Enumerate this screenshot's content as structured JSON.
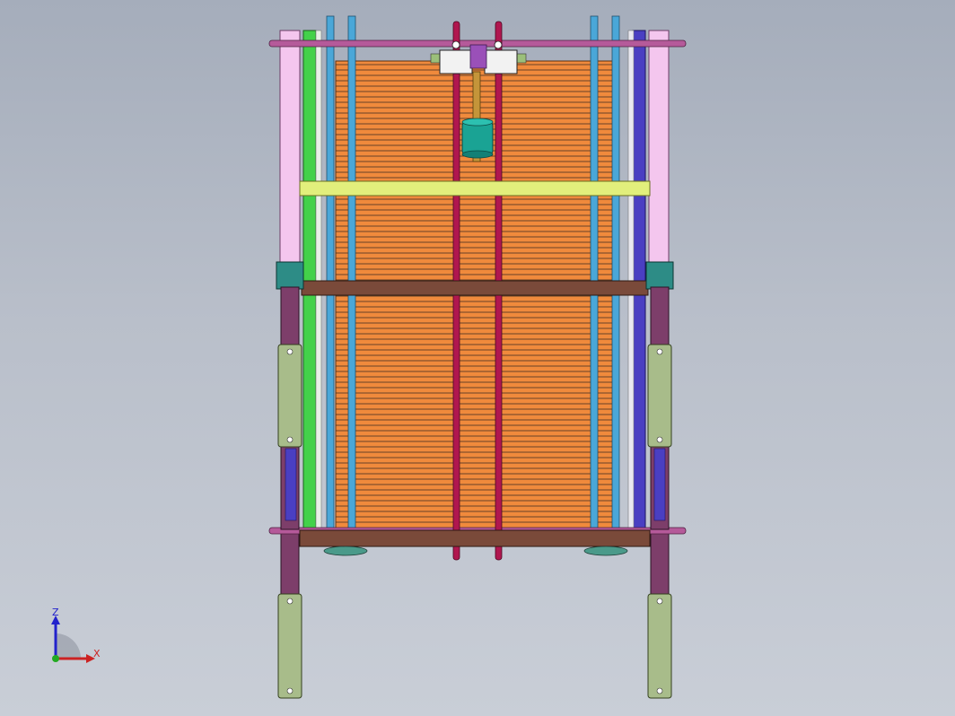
{
  "viewport": {
    "colors": {
      "background_top": "#a5adbb",
      "background_bottom": "#c9ced7",
      "pink_post": "#f4c6ee",
      "green_frame": "#43d14a",
      "purple_frame": "#4a3fc2",
      "blue_rod": "#4aa7d8",
      "crimson_rod": "#b0174f",
      "mauve_rod": "#b55a9a",
      "orange_plates": "#f08a3c",
      "plate_lines": "#3a2a20",
      "yellow_bar": "#e2ef7c",
      "brown_bar": "#7a4a3a",
      "teal_block": "#2d8c86",
      "leg_purple": "#7d3e6a",
      "clamp_green": "#a8bc8a",
      "cylinder_teal": "#1aa394",
      "screw_gold": "#c4953a",
      "bracket_white": "#f2f2f2"
    }
  },
  "triad": {
    "z_label": "Z",
    "x_label": "X",
    "z_color": "#2222cc",
    "x_color": "#cc2222",
    "y_color": "#22aa22"
  }
}
